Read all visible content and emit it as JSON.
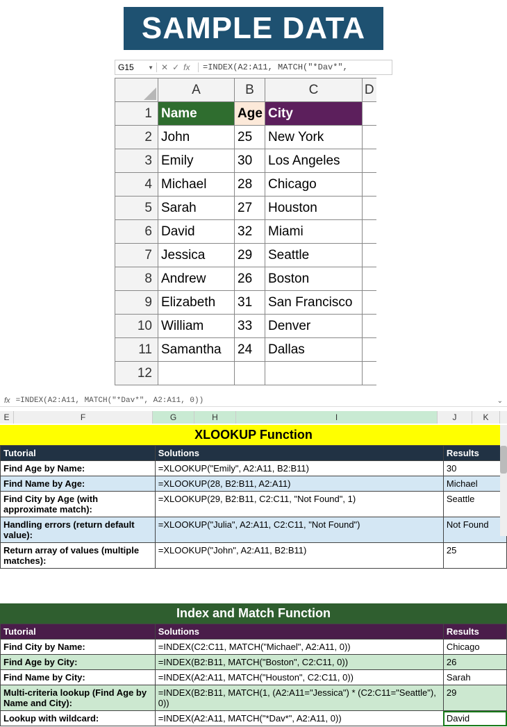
{
  "banner": "SAMPLE DATA",
  "excel1": {
    "name_box": "G15",
    "formula": "=INDEX(A2:A11, MATCH(\"*Dav*\",",
    "cols": [
      "A",
      "B",
      "C",
      "D"
    ],
    "headers": {
      "name": "Name",
      "age": "Age",
      "city": "City"
    },
    "rows": [
      {
        "n": "2",
        "name": "John",
        "age": "25",
        "city": "New York"
      },
      {
        "n": "3",
        "name": "Emily",
        "age": "30",
        "city": "Los Angeles"
      },
      {
        "n": "4",
        "name": "Michael",
        "age": "28",
        "city": "Chicago"
      },
      {
        "n": "5",
        "name": "Sarah",
        "age": "27",
        "city": "Houston"
      },
      {
        "n": "6",
        "name": "David",
        "age": "32",
        "city": "Miami"
      },
      {
        "n": "7",
        "name": "Jessica",
        "age": "29",
        "city": "Seattle"
      },
      {
        "n": "8",
        "name": "Andrew",
        "age": "26",
        "city": "Boston"
      },
      {
        "n": "9",
        "name": "Elizabeth",
        "age": "31",
        "city": "San Francisco"
      },
      {
        "n": "10",
        "name": "William",
        "age": "33",
        "city": "Denver"
      },
      {
        "n": "11",
        "name": "Samantha",
        "age": "24",
        "city": "Dallas"
      }
    ],
    "lastrow": "12"
  },
  "fb2": "=INDEX(A2:A11, MATCH(\"*Dav*\", A2:A11, 0))",
  "letters2": [
    "E",
    "F",
    "G",
    "H",
    "I",
    "J",
    "K"
  ],
  "xlookup": {
    "title": "XLOOKUP Function",
    "headers": {
      "t": "Tutorial",
      "s": "Solutions",
      "r": "Results"
    },
    "rows": [
      {
        "t": "Find Age by Name:",
        "s": "=XLOOKUP(\"Emily\", A2:A11, B2:B11)",
        "r": "30",
        "stripe": false
      },
      {
        "t": "Find Name by Age:",
        "s": "=XLOOKUP(28, B2:B11, A2:A11)",
        "r": "Michael",
        "stripe": true
      },
      {
        "t": "Find City by Age (with approximate match):",
        "s": "=XLOOKUP(29, B2:B11, C2:C11, \"Not Found\", 1)",
        "r": "Seattle",
        "stripe": false
      },
      {
        "t": "Handling errors (return default value):",
        "s": "=XLOOKUP(\"Julia\", A2:A11, C2:C11, \"Not Found\")",
        "r": "Not Found",
        "stripe": true
      },
      {
        "t": "Return array of values (multiple matches):",
        "s": "=XLOOKUP(\"John\", A2:A11, B2:B11)",
        "r": "25",
        "stripe": false
      }
    ]
  },
  "indexmatch": {
    "title": "Index and Match Function",
    "headers": {
      "t": "Tutorial",
      "s": "Solutions",
      "r": "Results"
    },
    "rows": [
      {
        "t": "Find City by Name:",
        "s": "=INDEX(C2:C11, MATCH(\"Michael\", A2:A11, 0))",
        "r": "Chicago",
        "stripe": false
      },
      {
        "t": "Find Age by City:",
        "s": "=INDEX(B2:B11, MATCH(\"Boston\", C2:C11, 0))",
        "r": "26",
        "stripe": true
      },
      {
        "t": "Find Name by City:",
        "s": "=INDEX(A2:A11, MATCH(\"Houston\", C2:C11, 0))",
        "r": "Sarah",
        "stripe": false
      },
      {
        "t": "Multi-criteria lookup (Find Age by Name and City):",
        "s": "=INDEX(B2:B11, MATCH(1, (A2:A11=\"Jessica\") * (C2:C11=\"Seattle\"), 0))",
        "r": "29",
        "stripe": true
      },
      {
        "t": "Lookup with wildcard:",
        "s": "=INDEX(A2:A11, MATCH(\"*Dav*\", A2:A11, 0))",
        "r": "David",
        "stripe": false,
        "selected": true
      }
    ]
  }
}
